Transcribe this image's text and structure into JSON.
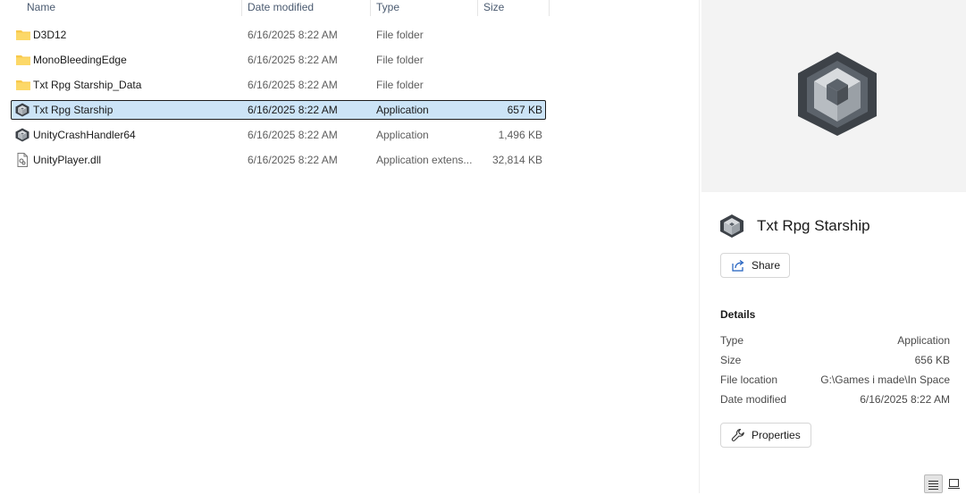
{
  "columns": {
    "name": "Name",
    "date_modified": "Date modified",
    "type": "Type",
    "size": "Size"
  },
  "files": [
    {
      "name": "D3D12",
      "date": "6/16/2025 8:22 AM",
      "type": "File folder",
      "size": "",
      "icon": "folder-icon",
      "selected": false
    },
    {
      "name": "MonoBleedingEdge",
      "date": "6/16/2025 8:22 AM",
      "type": "File folder",
      "size": "",
      "icon": "folder-icon",
      "selected": false
    },
    {
      "name": "Txt Rpg Starship_Data",
      "date": "6/16/2025 8:22 AM",
      "type": "File folder",
      "size": "",
      "icon": "folder-icon",
      "selected": false
    },
    {
      "name": "Txt Rpg Starship",
      "date": "6/16/2025 8:22 AM",
      "type": "Application",
      "size": "657 KB",
      "icon": "unity-app-icon",
      "selected": true
    },
    {
      "name": "UnityCrashHandler64",
      "date": "6/16/2025 8:22 AM",
      "type": "Application",
      "size": "1,496 KB",
      "icon": "unity-app-icon",
      "selected": false
    },
    {
      "name": "UnityPlayer.dll",
      "date": "6/16/2025 8:22 AM",
      "type": "Application extens...",
      "size": "32,814 KB",
      "icon": "dll-file-icon",
      "selected": false
    }
  ],
  "details_pane": {
    "title": "Txt Rpg Starship",
    "share_label": "Share",
    "details_heading": "Details",
    "properties": [
      {
        "label": "Type",
        "value": "Application"
      },
      {
        "label": "Size",
        "value": "656 KB"
      },
      {
        "label": "File location",
        "value": "G:\\Games i made\\In Space"
      },
      {
        "label": "Date modified",
        "value": "6/16/2025 8:22 AM"
      }
    ],
    "properties_label": "Properties"
  },
  "icons": {
    "preview": "unity-logo-icon",
    "share": "share-icon",
    "properties": "wrench-icon",
    "view_details": "details-view-icon",
    "view_tiles": "tiles-view-icon"
  },
  "colors": {
    "selection_bg": "#cce4f7",
    "folder": "#f8c94c",
    "unity_dark": "#4a4f55",
    "preview_bg": "#f3f3f3"
  }
}
